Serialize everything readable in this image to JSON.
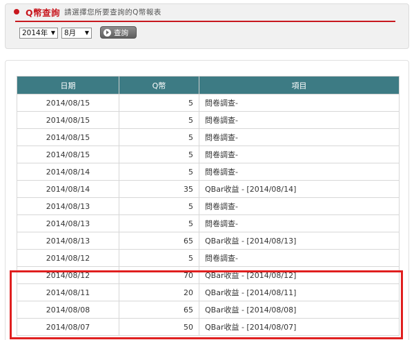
{
  "header": {
    "title": "Q幣查詢",
    "subtitle": "請選擇您所要查詢的Q幣報表"
  },
  "filters": {
    "year": "2014年",
    "month": "8月",
    "query_label": "查詢",
    "arrow_glyph": "▼"
  },
  "table": {
    "headers": [
      "日期",
      "Q幣",
      "項目"
    ],
    "rows": [
      {
        "date": "2014/08/15",
        "q": "5",
        "item": "問卷調查-"
      },
      {
        "date": "2014/08/15",
        "q": "5",
        "item": "問卷調查-"
      },
      {
        "date": "2014/08/15",
        "q": "5",
        "item": "問卷調查-"
      },
      {
        "date": "2014/08/15",
        "q": "5",
        "item": "問卷調查-"
      },
      {
        "date": "2014/08/14",
        "q": "5",
        "item": "問卷調查-"
      },
      {
        "date": "2014/08/14",
        "q": "35",
        "item": "QBar收益 - [2014/08/14]"
      },
      {
        "date": "2014/08/13",
        "q": "5",
        "item": "問卷調查-"
      },
      {
        "date": "2014/08/13",
        "q": "5",
        "item": "問卷調查-"
      },
      {
        "date": "2014/08/13",
        "q": "65",
        "item": "QBar收益 - [2014/08/13]"
      },
      {
        "date": "2014/08/12",
        "q": "5",
        "item": "問卷調查-"
      },
      {
        "date": "2014/08/12",
        "q": "70",
        "item": "QBar收益 - [2014/08/12]"
      },
      {
        "date": "2014/08/11",
        "q": "20",
        "item": "QBar收益 - [2014/08/11]"
      },
      {
        "date": "2014/08/08",
        "q": "65",
        "item": "QBar收益 - [2014/08/08]"
      },
      {
        "date": "2014/08/07",
        "q": "50",
        "item": "QBar收益 - [2014/08/07]"
      }
    ]
  },
  "colors": {
    "accent_red": "#c8171e",
    "header_teal": "#3d7b84",
    "highlight_red": "#e01f1f"
  }
}
